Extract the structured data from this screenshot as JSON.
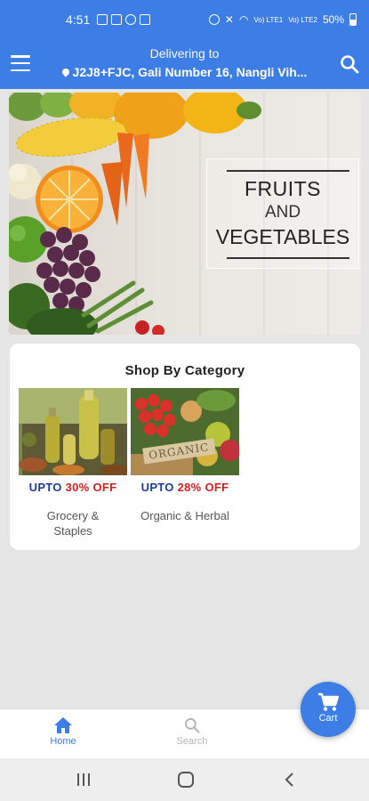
{
  "status_bar": {
    "time": "4:51",
    "battery": "50%",
    "net1": "Vo) LTE1",
    "net2": "Vo) LTE2"
  },
  "header": {
    "delivering_label": "Delivering to",
    "address": "J2J8+FJC, Gali Number 16, Nangli Vih..."
  },
  "banner": {
    "line1": "FRUITS",
    "line2": "AND",
    "line3": "VEGETABLES"
  },
  "category_section": {
    "title": "Shop By Category",
    "items": [
      {
        "offer_prefix": "UPTO",
        "offer_pct": "30% OFF",
        "name_line1": "Grocery &",
        "name_line2": "Staples"
      },
      {
        "offer_prefix": "UPTO",
        "offer_pct": "28% OFF",
        "name_line1": "Organic & Herbal",
        "name_line2": "",
        "tag": "ORGANIC"
      }
    ]
  },
  "bottom_nav": {
    "home_label": "Home",
    "search_label": "Search",
    "cart_label": "Cart"
  },
  "colors": {
    "primary": "#3d7de6",
    "offer_blue": "#1f3d99",
    "offer_red": "#d81d1d"
  }
}
